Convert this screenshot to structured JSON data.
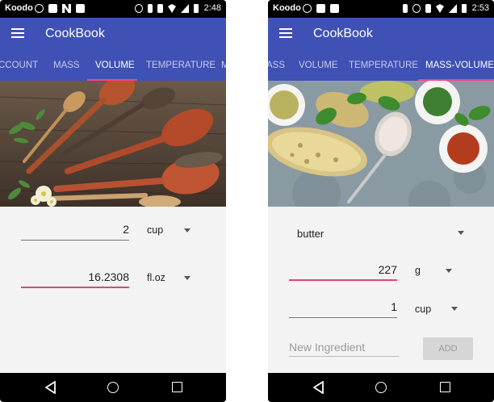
{
  "phones": [
    {
      "status": {
        "carrier": "Koodo",
        "time": "2:48"
      },
      "app_title": "CookBook",
      "tabs": [
        "CCOUNT",
        "MASS",
        "VOLUME",
        "TEMPERATURE",
        "M"
      ],
      "active_tab": "VOLUME",
      "fields": [
        {
          "value": "2",
          "unit": "cup"
        },
        {
          "value": "16.2308",
          "unit": "fl.oz"
        }
      ]
    },
    {
      "status": {
        "carrier": "Koodo",
        "time": "2:53"
      },
      "app_title": "CookBook",
      "tabs": [
        "ASS",
        "VOLUME",
        "TEMPERATURE",
        "MASS-VOLUME"
      ],
      "active_tab": "MASS-VOLUME",
      "ingredient": "butter",
      "fields": [
        {
          "value": "227",
          "unit": "g"
        },
        {
          "value": "1",
          "unit": "cup"
        }
      ],
      "new_ingredient_placeholder": "New Ingredient",
      "add_label": "ADD"
    }
  ],
  "icons": {
    "menu": "hamburger-icon",
    "back": "back-triangle-icon",
    "home": "home-circle-icon",
    "recents": "recents-square-icon"
  },
  "colors": {
    "primary": "#3f51b5",
    "accent": "#ff4081",
    "focus_underline": "#e0457b"
  }
}
